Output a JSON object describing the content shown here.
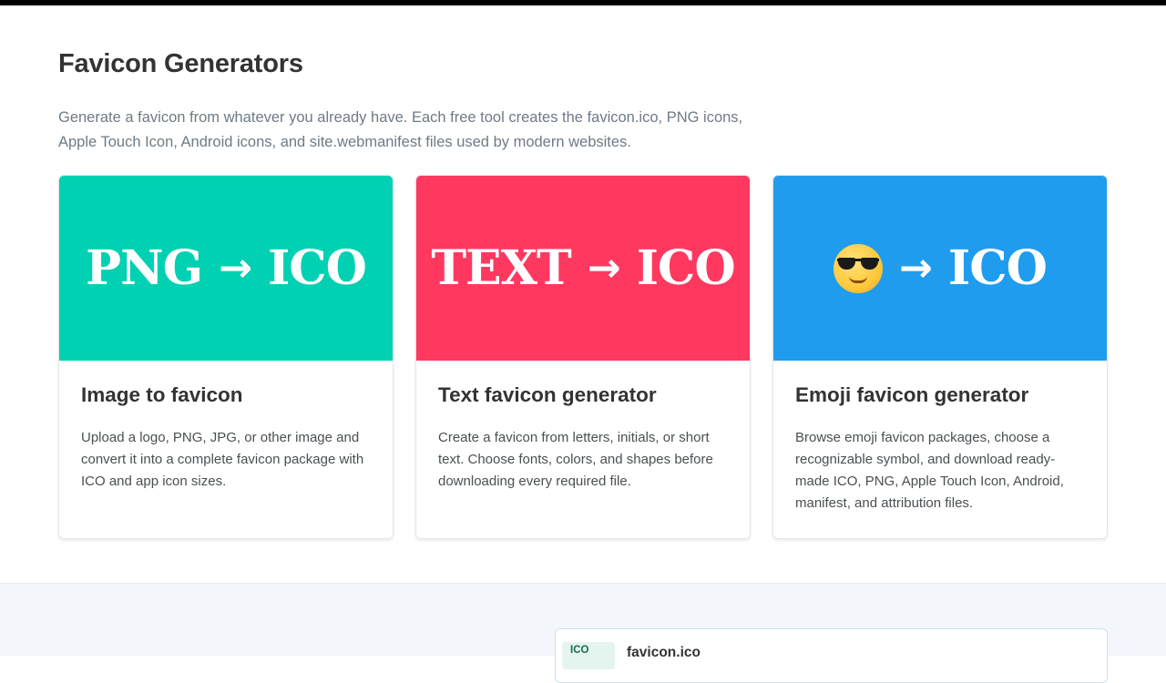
{
  "section": {
    "title": "Favicon Generators",
    "description": "Generate a favicon from whatever you already have. Each free tool creates the favicon.ico, PNG icons, Apple Touch Icon, Android icons, and site.webmanifest files used by modern websites."
  },
  "cards": [
    {
      "banner_from": "PNG",
      "banner_arrow": "→",
      "banner_to": "ICO",
      "banner_color": "#00d1b2",
      "title": "Image to favicon",
      "text": "Upload a logo, PNG, JPG, or other image and convert it into a complete favicon package with ICO and app icon sizes."
    },
    {
      "banner_from": "TEXT",
      "banner_arrow": "→",
      "banner_to": "ICO",
      "banner_color": "#ff3860",
      "title": "Text favicon generator",
      "text": "Create a favicon from letters, initials, or short text. Choose fonts, colors, and shapes before downloading every required file."
    },
    {
      "banner_from_icon": "sunglasses-emoji-icon",
      "banner_arrow": "→",
      "banner_to": "ICO",
      "banner_color": "#209cee",
      "title": "Emoji favicon generator",
      "text": "Browse emoji favicon packages, choose a recognizable symbol, and download ready-made ICO, PNG, Apple Touch Icon, Android, manifest, and attribution files."
    }
  ],
  "file_list": {
    "badge": "ICO",
    "name": "favicon.ico"
  }
}
